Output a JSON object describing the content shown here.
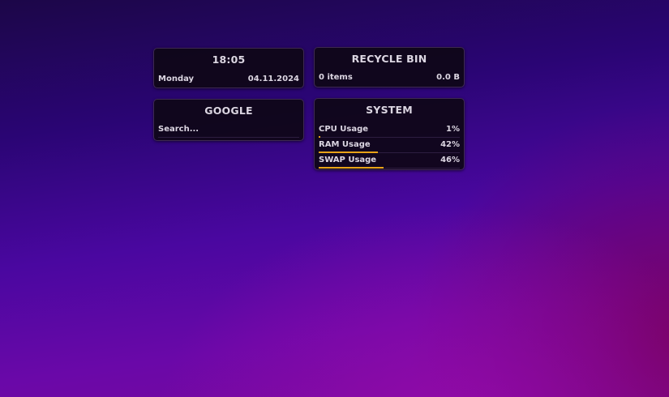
{
  "clock": {
    "time": "18:05",
    "day": "Monday",
    "date": "04.11.2024"
  },
  "recycle_bin": {
    "title": "RECYCLE BIN",
    "items": "0 items",
    "size": "0.0 B"
  },
  "google": {
    "title": "GOOGLE",
    "search_placeholder": "Search..."
  },
  "system": {
    "title": "SYSTEM",
    "rows": [
      {
        "label": "CPU Usage",
        "value": "1%",
        "fraction": 0.01
      },
      {
        "label": "RAM Usage",
        "value": "42%",
        "fraction": 0.42
      },
      {
        "label": "SWAP Usage",
        "value": "46%",
        "fraction": 0.46
      }
    ],
    "bar_color": "#e8a318"
  },
  "colors": {
    "widget_bg": "#0e0616",
    "text": "#dcd6e2",
    "accent": "#e8a318"
  }
}
